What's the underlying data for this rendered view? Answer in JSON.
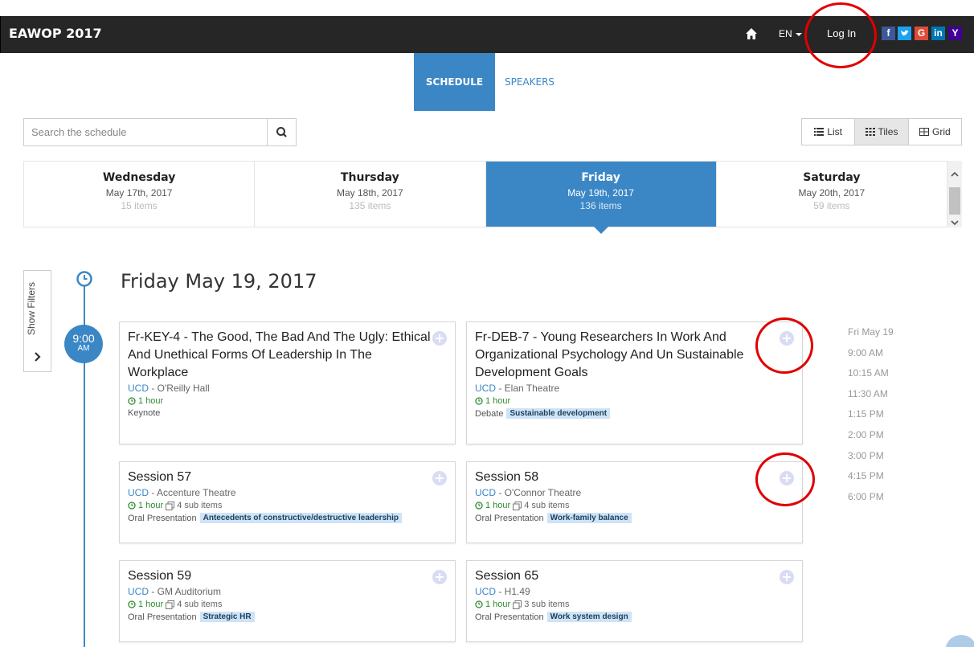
{
  "navbar": {
    "brand": "EAWOP 2017",
    "language": "EN",
    "login_label": "Log In",
    "social": {
      "facebook": "f",
      "twitter": "t",
      "google": "G",
      "linkedin": "in",
      "yahoo": "Y"
    }
  },
  "tabs": {
    "schedule": "SCHEDULE",
    "speakers": "SPEAKERS"
  },
  "search": {
    "placeholder": "Search the schedule",
    "value": ""
  },
  "views": {
    "list": "List",
    "tiles": "Tiles",
    "grid": "Grid",
    "active": "Tiles"
  },
  "days": [
    {
      "name": "Wednesday",
      "date": "May 17th, 2017",
      "items": "15 items"
    },
    {
      "name": "Thursday",
      "date": "May 18th, 2017",
      "items": "135 items"
    },
    {
      "name": "Friday",
      "date": "May 19th, 2017",
      "items": "136 items",
      "active": true
    },
    {
      "name": "Saturday",
      "date": "May 20th, 2017",
      "items": "59 items"
    }
  ],
  "filters_label": "Show Filters",
  "heading": "Friday May 19, 2017",
  "timeline": {
    "time": "9:00",
    "ampm": "AM"
  },
  "cards": [
    {
      "title": "Fr-KEY-4 - The Good, The Bad And The Ugly: Ethical And Unethical Forms Of Leadership In The Workplace",
      "org": "UCD",
      "sep": " - ",
      "room": "O'Reilly Hall",
      "duration": "1 hour",
      "sub": "",
      "type": "Keynote",
      "tag": ""
    },
    {
      "title": "Fr-DEB-7 - Young Researchers In Work And Organizational Psychology And Un Sustainable Development Goals",
      "org": "UCD",
      "sep": " - ",
      "room": "Elan Theatre",
      "duration": "1 hour",
      "sub": "",
      "type": "Debate",
      "tag": "Sustainable development"
    },
    {
      "title": "Session 57",
      "org": "UCD",
      "sep": " - ",
      "room": "Accenture Theatre",
      "duration": "1 hour",
      "sub": "4 sub items",
      "type": "Oral Presentation",
      "tag": "Antecedents of constructive/destructive leadership"
    },
    {
      "title": "Session 58",
      "org": "UCD",
      "sep": " - ",
      "room": "O'Connor Theatre",
      "duration": "1 hour",
      "sub": "4 sub items",
      "type": "Oral Presentation",
      "tag": "Work-family balance"
    },
    {
      "title": "Session 59",
      "org": "UCD",
      "sep": " - ",
      "room": "GM Auditorium",
      "duration": "1 hour",
      "sub": "4 sub items",
      "type": "Oral Presentation",
      "tag": "Strategic HR"
    },
    {
      "title": "Session 65",
      "org": "UCD",
      "sep": " - ",
      "room": "H1.49",
      "duration": "1 hour",
      "sub": "3 sub items",
      "type": "Oral Presentation",
      "tag": "Work system design"
    }
  ],
  "rail": [
    "Fri May 19",
    "9:00 AM",
    "10:15 AM",
    "11:30 AM",
    "1:15 PM",
    "2:00 PM",
    "3:00 PM",
    "4:15 PM",
    "6:00 PM"
  ],
  "colors": {
    "accent": "#3b87c6",
    "navbar": "#262626",
    "annotation": "#e00000"
  }
}
